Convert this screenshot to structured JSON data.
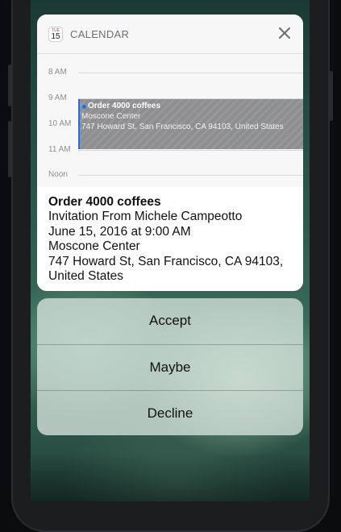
{
  "notification": {
    "app_icon_day": "TUE",
    "app_icon_date": "15",
    "app_name": "CALENDAR",
    "timeline": {
      "time_labels": [
        "8 AM",
        "9 AM",
        "10 AM",
        "11 AM",
        "Noon"
      ],
      "event": {
        "title": "Order 4000 coffees",
        "location": "Moscone Center",
        "address": "747 Howard St, San Francisco, CA  94103, United States"
      }
    },
    "details": {
      "title": "Order 4000 coffees",
      "invitation": "Invitation From Michele Campeotto",
      "datetime": "June 15, 2016 at 9:00 AM",
      "location": "Moscone Center",
      "address_line1": "747 Howard St, San Francisco, CA  94103,",
      "address_line2": "United States"
    }
  },
  "actions": {
    "accept": "Accept",
    "maybe": "Maybe",
    "decline": "Decline"
  },
  "colors": {
    "event_accent": "#1e6fe0",
    "app_icon_red": "#e0372c"
  }
}
